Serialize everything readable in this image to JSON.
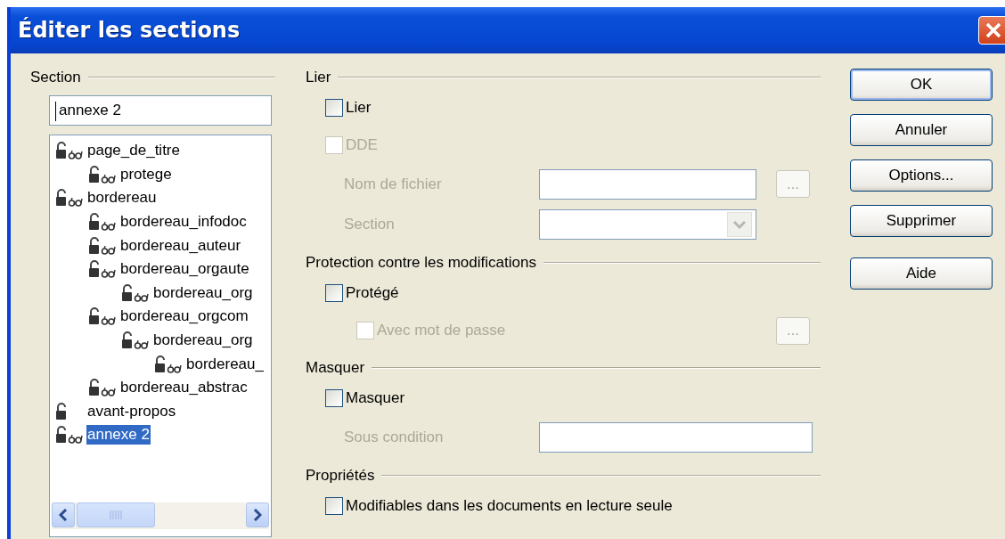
{
  "window": {
    "title": "Éditer les sections"
  },
  "section_panel": {
    "heading": "Section",
    "name_field": {
      "value": "annexe 2"
    },
    "tree": [
      {
        "label": "page_de_titre",
        "linked": true,
        "selected": false,
        "children": [
          {
            "label": "protege",
            "linked": true,
            "selected": false
          }
        ]
      },
      {
        "label": "bordereau",
        "linked": true,
        "selected": false,
        "children": [
          {
            "label": "bordereau_infodoc",
            "linked": true,
            "selected": false
          },
          {
            "label": "bordereau_auteur",
            "linked": true,
            "selected": false
          },
          {
            "label": "bordereau_orgaute",
            "linked": true,
            "selected": false,
            "children": [
              {
                "label": "bordereau_org",
                "linked": true,
                "selected": false
              }
            ]
          },
          {
            "label": "bordereau_orgcom",
            "linked": true,
            "selected": false,
            "children": [
              {
                "label": "bordereau_org",
                "linked": true,
                "selected": false,
                "children": [
                  {
                    "label": "bordereau_",
                    "linked": true,
                    "selected": false
                  }
                ]
              }
            ]
          },
          {
            "label": "bordereau_abstrac",
            "linked": true,
            "selected": false
          }
        ]
      },
      {
        "label": "avant-propos",
        "linked": false,
        "selected": false
      },
      {
        "label": "annexe 2",
        "linked": true,
        "selected": true
      }
    ]
  },
  "groups": [
    {
      "heading": "Lier",
      "rows": [
        {
          "kind": "checkbox",
          "label": "Lier",
          "checked": false,
          "disabled": false
        },
        {
          "kind": "checkbox",
          "label": "DDE",
          "checked": false,
          "disabled": true
        },
        {
          "kind": "field",
          "label": "Nom de fichier",
          "disabled": true,
          "browse": "..."
        },
        {
          "kind": "combo",
          "label": "Section",
          "disabled": true
        }
      ]
    },
    {
      "heading": "Protection contre les modifications",
      "rows": [
        {
          "kind": "checkbox",
          "label": "Protégé",
          "checked": false,
          "disabled": false,
          "children": [
            {
              "kind": "checkbox",
              "label": "Avec mot de passe",
              "checked": false,
              "disabled": true,
              "browse": "..."
            }
          ]
        }
      ]
    },
    {
      "heading": "Masquer",
      "rows": [
        {
          "kind": "checkbox",
          "label": "Masquer",
          "checked": false,
          "disabled": false
        },
        {
          "kind": "field",
          "label": "Sous condition",
          "disabled": true
        }
      ]
    },
    {
      "heading": "Propriétés",
      "rows": [
        {
          "kind": "checkbox",
          "label": "Modifiables dans les documents en lecture seule",
          "checked": false,
          "disabled": false
        }
      ]
    }
  ],
  "buttons": [
    {
      "label": "OK",
      "default": true
    },
    {
      "label": "Annuler",
      "default": false
    },
    {
      "label": "Options...",
      "default": false
    },
    {
      "label": "Supprimer",
      "default": false
    },
    {
      "label": "Aide",
      "default": false
    }
  ]
}
